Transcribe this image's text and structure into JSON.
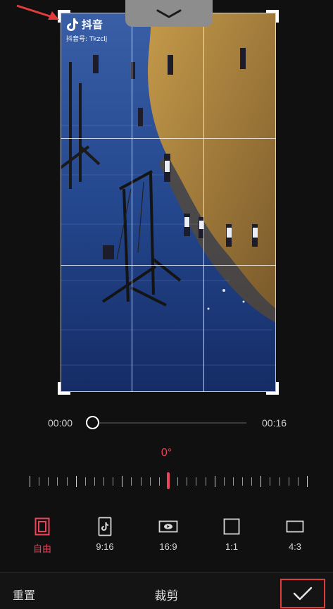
{
  "watermark": {
    "app_name": "抖音",
    "account_id": "抖音号: Tkzclj"
  },
  "timeline": {
    "start_time": "00:00",
    "end_time": "00:16",
    "progress": 0
  },
  "rotation": {
    "value": "0°"
  },
  "ratio_options": [
    {
      "label": "自由",
      "icon": "free-crop-icon",
      "active": true
    },
    {
      "label": "9:16",
      "icon": "tiktok-9-16-icon",
      "active": false
    },
    {
      "label": "16:9",
      "icon": "youtube-16-9-icon",
      "active": false
    },
    {
      "label": "1:1",
      "icon": "square-1-1-icon",
      "active": false
    },
    {
      "label": "4:3",
      "icon": "rect-4-3-icon",
      "active": false
    }
  ],
  "bottom_bar": {
    "reset_label": "重置",
    "title": "裁剪",
    "confirm_icon": "checkmark-icon"
  },
  "colors": {
    "accent": "#e8445a",
    "annotation": "#e23b3b",
    "background": "#101010"
  }
}
